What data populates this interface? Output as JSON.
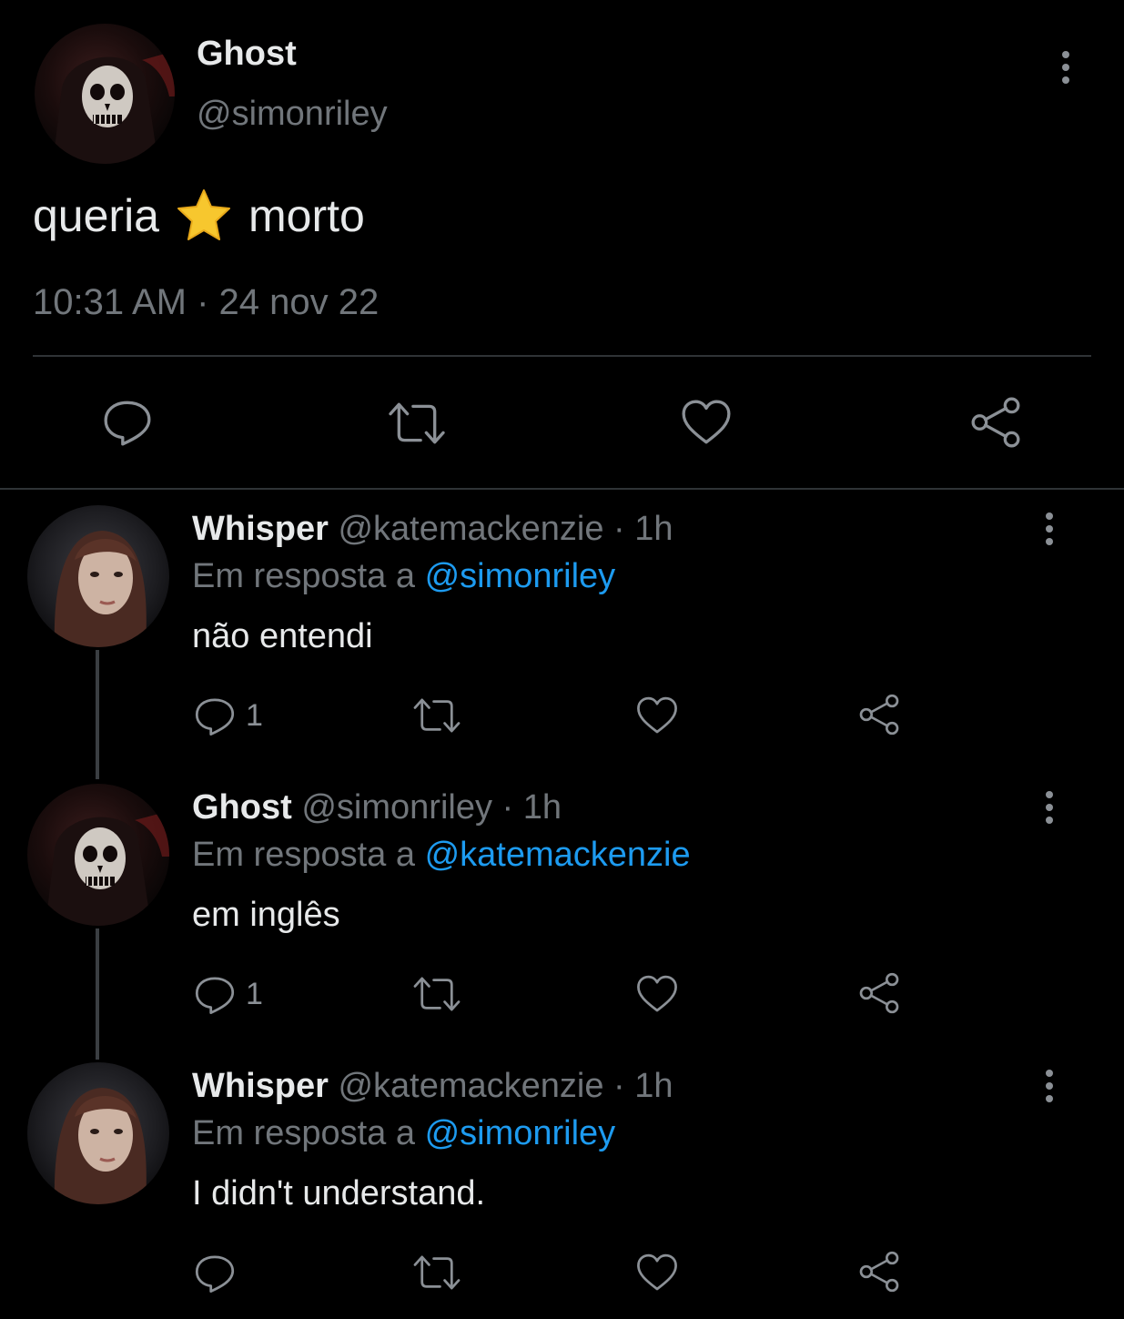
{
  "main_tweet": {
    "author_name": "Ghost",
    "author_handle": "@simonriley",
    "text_before": "queria",
    "emoji": "⭐",
    "text_after": "morto",
    "timestamp": "10:31 AM · 24 nov 22"
  },
  "replies": [
    {
      "name": "Whisper",
      "meta": "@katemackenzie · 1h",
      "reply_prefix": "Em resposta a",
      "reply_to": "@simonriley",
      "text": "não entendi",
      "reply_count": "1"
    },
    {
      "name": "Ghost",
      "meta": "@simonriley · 1h",
      "reply_prefix": "Em resposta a",
      "reply_to": "@katemackenzie",
      "text": "em inglês",
      "reply_count": "1"
    },
    {
      "name": "Whisper",
      "meta": "@katemackenzie · 1h",
      "reply_prefix": "Em resposta a",
      "reply_to": "@simonriley",
      "text": "I didn't understand.",
      "reply_count": ""
    }
  ],
  "colors": {
    "background": "#000000",
    "text": "#e7e9ea",
    "muted": "#71767b",
    "link": "#1d9bf0",
    "icon": "#8b9096"
  },
  "icons": [
    "reply-icon",
    "retweet-icon",
    "like-icon",
    "share-icon",
    "more-options-icon"
  ]
}
